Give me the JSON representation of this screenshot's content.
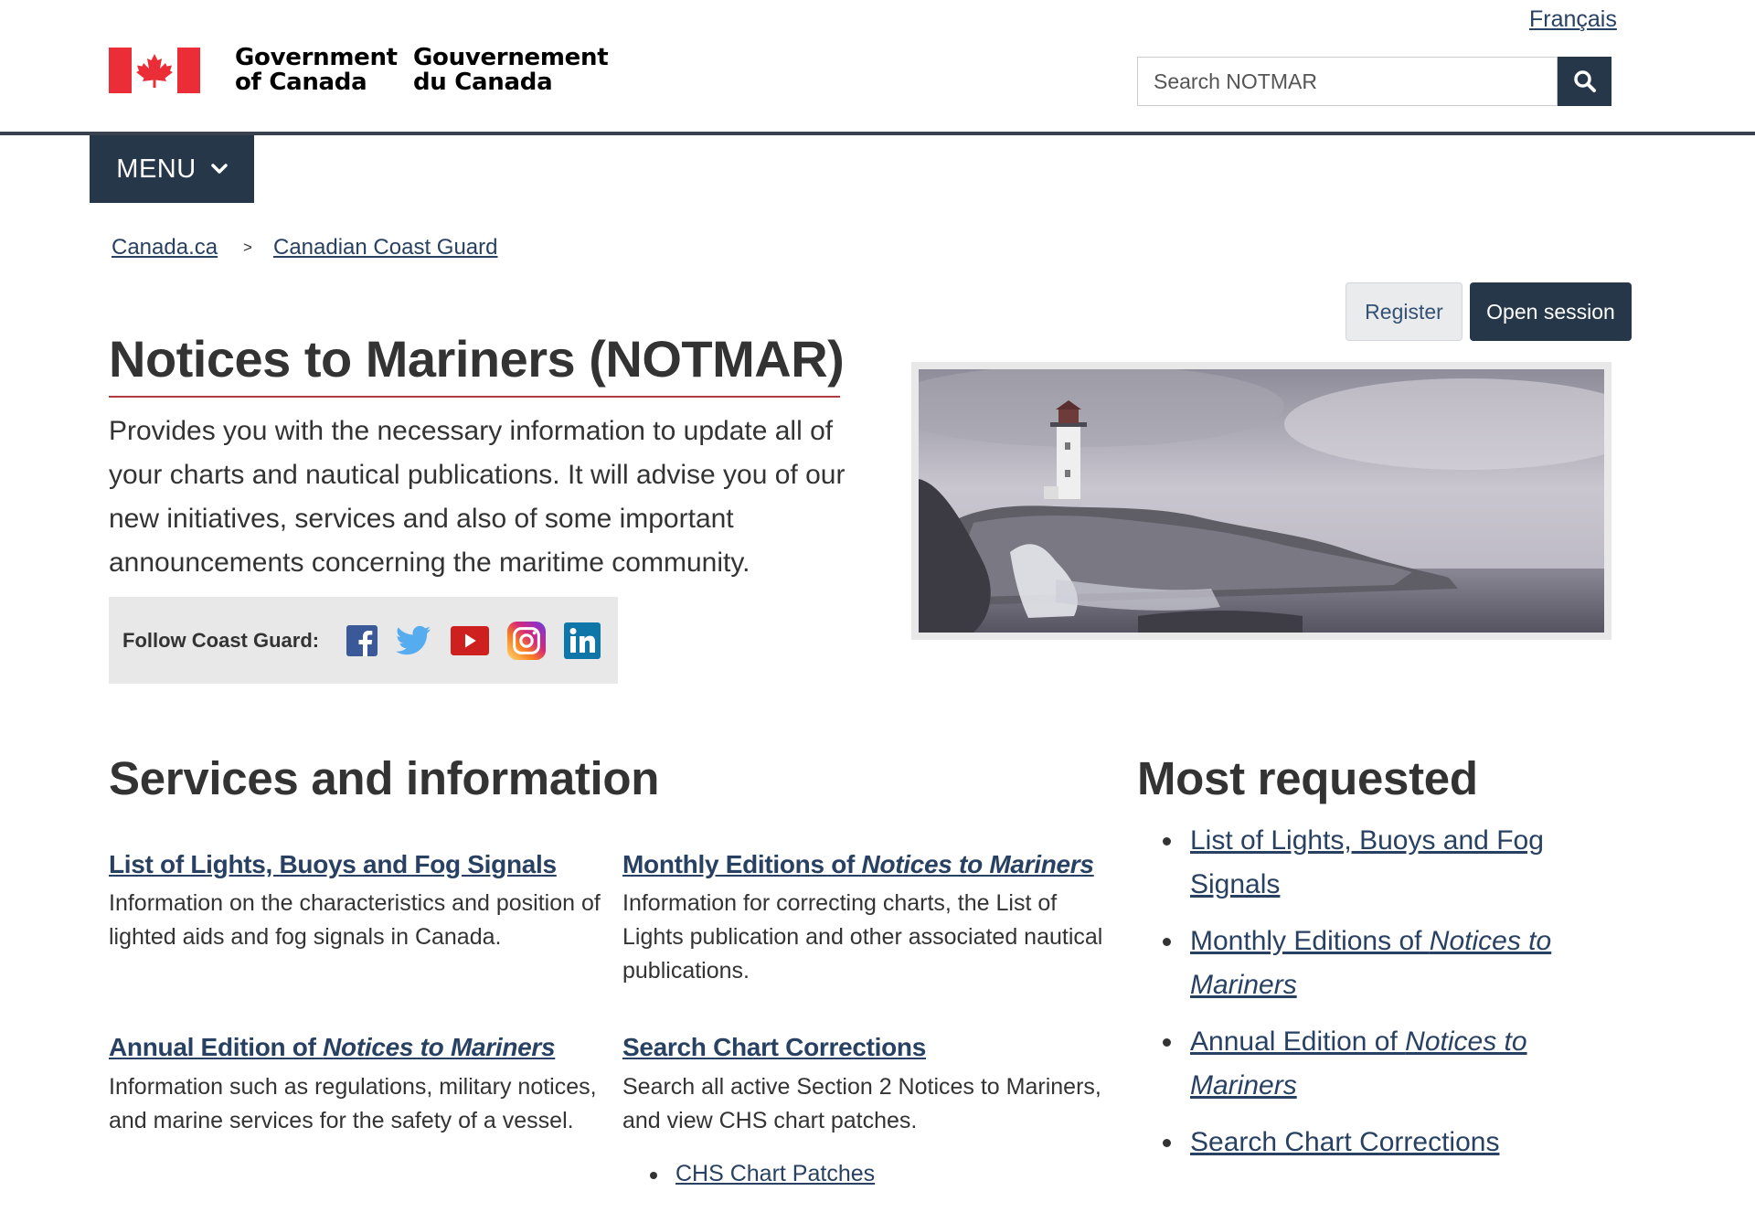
{
  "header": {
    "language_link": "Français",
    "signature_en_line1": "Government",
    "signature_en_line2": "of Canada",
    "signature_fr_line1": "Gouvernement",
    "signature_fr_line2": "du Canada",
    "search_placeholder": "Search NOTMAR",
    "search_icon": "search-icon",
    "menu_label": "MENU",
    "menu_icon": "chevron-down-icon"
  },
  "breadcrumb": {
    "items": [
      "Canada.ca",
      "Canadian Coast Guard"
    ],
    "separator": ">"
  },
  "session": {
    "register_label": "Register",
    "open_session_label": "Open session"
  },
  "main": {
    "title": "Notices to Mariners (NOTMAR)",
    "intro": "Provides you with the necessary information to update all of your charts and nautical publications. It will advise you of our new initiatives, services and also of some important announcements concerning the maritime community.",
    "social": {
      "label": "Follow Coast Guard:",
      "icons": [
        "facebook-icon",
        "twitter-icon",
        "youtube-icon",
        "instagram-icon",
        "linkedin-icon"
      ]
    }
  },
  "services": {
    "heading": "Services and information",
    "items": [
      {
        "title": "List of Lights, Buoys and Fog Signals",
        "description": "Information on the characteristics and position of lighted aids and fog signals in Canada."
      },
      {
        "title_prefix": "Monthly Editions of ",
        "title_italic": "Notices to Mariners",
        "description": "Information for correcting charts, the List of Lights publication and other associated nautical publications."
      },
      {
        "title_prefix": "Annual Edition of ",
        "title_italic": "Notices to Mariners",
        "description": "Information such as regulations, military notices, and marine services for the safety of a vessel."
      },
      {
        "title": "Search Chart Corrections",
        "description": "Search all active Section 2 Notices to Mariners, and view CHS chart patches.",
        "sub_link": "CHS Chart Patches"
      }
    ]
  },
  "most_requested": {
    "heading": "Most requested",
    "items": [
      {
        "text": "List of Lights, Buoys and Fog Signals"
      },
      {
        "prefix": "Monthly Editions of ",
        "italic": "Notices to Mariners"
      },
      {
        "prefix": "Annual Edition of ",
        "italic": "Notices to Mariners"
      },
      {
        "text": "Search Chart Corrections"
      }
    ]
  },
  "colors": {
    "header_dark": "#26374a",
    "link": "#284162",
    "title_rule": "#af3c43",
    "flag_red": "#eb2d37"
  }
}
